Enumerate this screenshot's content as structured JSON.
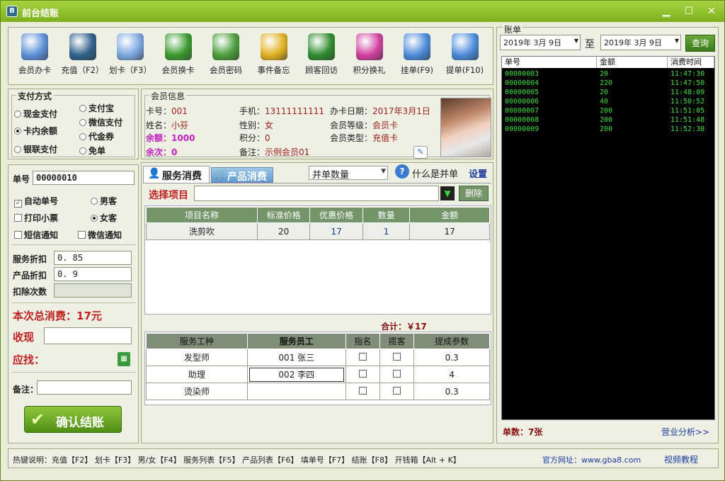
{
  "window": {
    "title": "前台结账"
  },
  "toolbar": [
    {
      "label": "会员办卡",
      "icon": "member-card-icon",
      "color": "#5b8fd6"
    },
    {
      "label": "充值（F2）",
      "icon": "money-bag-icon",
      "color": "#2f5f8a"
    },
    {
      "label": "划卡（F3）",
      "icon": "card-swipe-icon",
      "color": "#7aa6e0"
    },
    {
      "label": "会员换卡",
      "icon": "refresh-icon",
      "color": "#3a9a2c"
    },
    {
      "label": "会员密码",
      "icon": "star-icon",
      "color": "#4a9e3a"
    },
    {
      "label": "事件备忘",
      "icon": "memo-icon",
      "color": "#e0b020"
    },
    {
      "label": "顾客回访",
      "icon": "phone-icon",
      "color": "#2e8b2e"
    },
    {
      "label": "积分换礼",
      "icon": "gift-icon",
      "color": "#d040a0"
    },
    {
      "label": "挂单(F9)",
      "icon": "clipboard-up-icon",
      "color": "#4a8ad8"
    },
    {
      "label": "提单(F10)",
      "icon": "clipboard-down-icon",
      "color": "#4a8ad8"
    }
  ],
  "payment": {
    "title": "支付方式",
    "options": [
      "现金支付",
      "卡内余额",
      "银联支付",
      "支付宝",
      "微信支付",
      "代金券",
      "免单"
    ],
    "selected": "卡内余额"
  },
  "member": {
    "title": "会员信息",
    "card_no_label": "卡号：",
    "card_no": "001",
    "name_label": "姓名：",
    "name": "小芬",
    "balance_label": "余额：",
    "balance": "1000",
    "times_label": "余次：",
    "times": "0",
    "phone_label": "手机：",
    "phone": "13111111111",
    "gender_label": "性别：",
    "gender": "女",
    "points_label": "积分：",
    "points": "0",
    "note_label": "备注：",
    "note": "示例会员01",
    "date_label": "办卡日期：",
    "date": "2017年3月1日",
    "level_label": "会员等级：",
    "level": "会员卡",
    "type_label": "会员类型：",
    "type": "充值卡"
  },
  "order": {
    "no_label": "单号",
    "no": "00000010",
    "auto_no": "自动单号",
    "print_ticket": "打印小票",
    "sms": "短信通知",
    "male": "男客",
    "female": "女客",
    "wechat": "微信通知",
    "service_discount_label": "服务折扣",
    "service_discount": "0. 85",
    "product_discount_label": "产品折扣",
    "product_discount": "0. 9",
    "deduct_label": "扣除次数",
    "total_label": "本次总消费：",
    "total": "17元",
    "received_label": "收现",
    "change_label": "应找：",
    "remark_label": "备注：",
    "confirm": "确认结账"
  },
  "tabs": {
    "service": "服务消费",
    "product": "产品消费",
    "merge_select": "并单数量",
    "merge_help": "什么是并单",
    "settings": "设置"
  },
  "service": {
    "select_label": "选择项目",
    "delete": "删除",
    "headers": [
      "项目名称",
      "标准价格",
      "优惠价格",
      "数量",
      "金额"
    ],
    "rows": [
      [
        "洗剪吹",
        "20",
        "17",
        "1",
        "17"
      ]
    ],
    "sum_label": "合计：￥17"
  },
  "staff": {
    "headers": [
      "服务工种",
      "服务员工",
      "指名",
      "揽客",
      "提成参数"
    ],
    "rows": [
      [
        "发型师",
        "001 张三",
        "0.3"
      ],
      [
        "助理",
        "002 李四",
        "4"
      ],
      [
        "烫染师",
        "",
        "0.3"
      ]
    ]
  },
  "bills": {
    "title": "账单",
    "from": "2019年 3月 9日",
    "to_label": "至",
    "to": "2019年 3月 9日",
    "query": "查询",
    "headers": [
      "单号",
      "金额",
      "消费时间"
    ],
    "rows": [
      [
        "00000003",
        "20",
        "11:47:30"
      ],
      [
        "00000004",
        "220",
        "11:47:50"
      ],
      [
        "00000005",
        "20",
        "11:48:09"
      ],
      [
        "00000006",
        "40",
        "11:50:52"
      ],
      [
        "00000007",
        "200",
        "11:51:05"
      ],
      [
        "00000008",
        "200",
        "11:51:48"
      ],
      [
        "00000009",
        "200",
        "11:52:38"
      ]
    ],
    "count_label": "单数：7张",
    "analysis": "营业分析>>"
  },
  "statusbar": {
    "hotkeys": "热键说明：充值【F2】  划卡【F3】  男/女【F4】 服务列表【F5】 产品列表【F6】 填单号【F7】 结账【F8】 开钱箱【Alt + K】",
    "site": "官方网址：www.gba8.com",
    "video": "视频教程"
  }
}
